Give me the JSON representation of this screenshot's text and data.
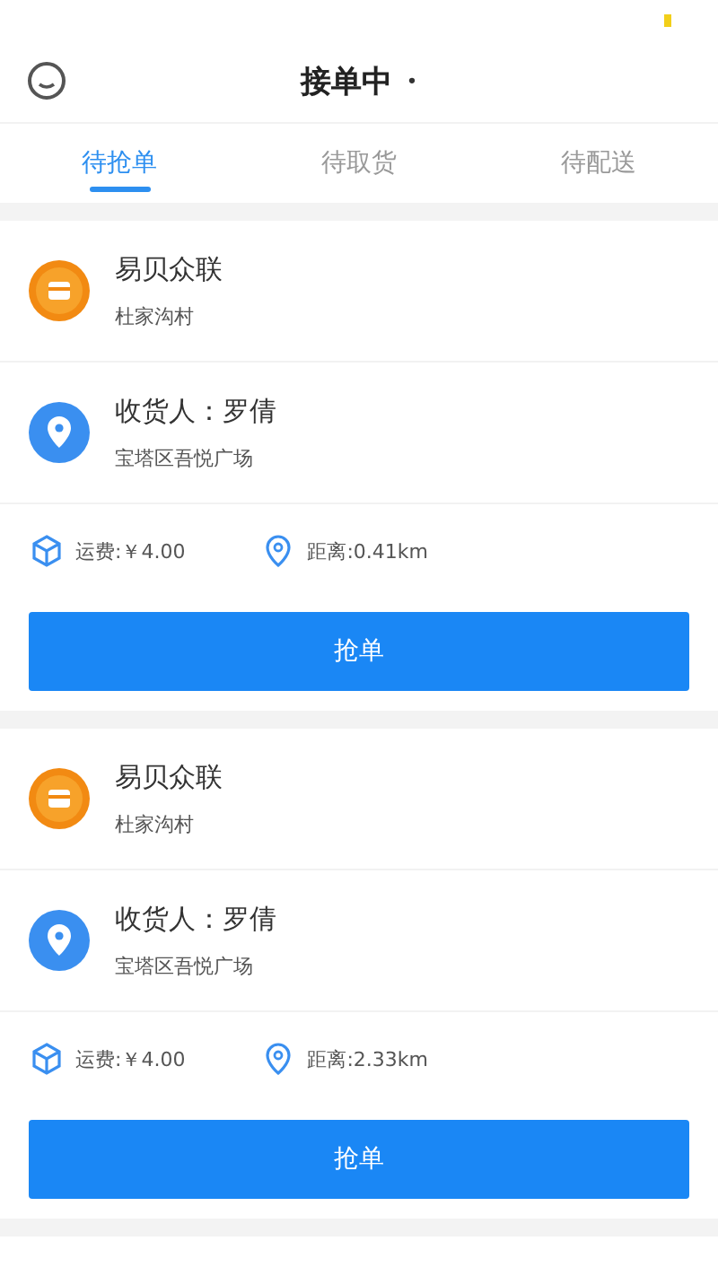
{
  "header": {
    "title": "接单中",
    "caret": "•"
  },
  "tabs": [
    {
      "label": "待抢单",
      "selected": true
    },
    {
      "label": "待取货",
      "selected": false
    },
    {
      "label": "待配送",
      "selected": false
    }
  ],
  "orders": [
    {
      "shop": "易贝众联",
      "shop_address": "杜家沟村",
      "receiver": "收货人：罗倩",
      "receiver_address": "宝塔区吾悦广场",
      "fee": "运费:￥4.00",
      "distance": "距离:0.41km",
      "action": "抢单"
    },
    {
      "shop": "易贝众联",
      "shop_address": "杜家沟村",
      "receiver": "收货人：罗倩",
      "receiver_address": "宝塔区吾悦广场",
      "fee": "运费:￥4.00",
      "distance": "距离:2.33km",
      "action": "抢单"
    }
  ]
}
